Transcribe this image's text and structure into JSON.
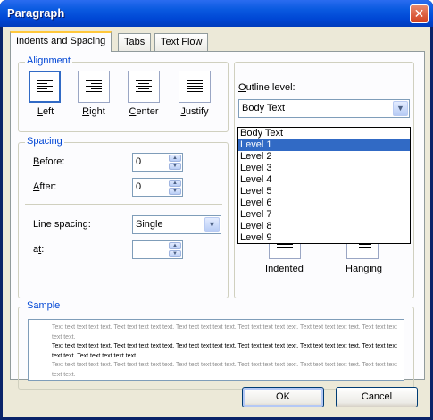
{
  "window": {
    "title": "Paragraph",
    "close_symbol": "✕"
  },
  "tabs": [
    {
      "label": "Indents and Spacing",
      "active": true
    },
    {
      "label": "Tabs",
      "active": false
    },
    {
      "label": "Text Flow",
      "active": false
    }
  ],
  "alignment": {
    "group_label": "Alignment",
    "options": [
      {
        "label_ul": "L",
        "label_rest": "eft",
        "selected": true
      },
      {
        "label_ul": "R",
        "label_rest": "ight",
        "selected": false
      },
      {
        "label_ul": "C",
        "label_rest": "enter",
        "selected": false
      },
      {
        "label_ul": "J",
        "label_rest": "ustify",
        "selected": false
      }
    ]
  },
  "spacing": {
    "group_label": "Spacing",
    "before_ul": "B",
    "before_rest": "efore:",
    "before_value": "0",
    "after_ul": "A",
    "after_rest": "fter:",
    "after_value": "0",
    "line_spacing_label": "Line spacing:",
    "line_spacing_value": "Single",
    "at_pre": "a",
    "at_ul": "t",
    "at_post": ":",
    "at_value": ""
  },
  "outline": {
    "label_ul": "O",
    "label_rest": "utline level:",
    "selected_value": "Body Text",
    "options": [
      "Body Text",
      "Level 1",
      "Level 2",
      "Level 3",
      "Level 4",
      "Level 5",
      "Level 6",
      "Level 7",
      "Level 8",
      "Level 9"
    ],
    "highlighted_index": 1
  },
  "indent_buttons": {
    "indented_ul": "I",
    "indented_rest": "ndented",
    "hanging_ul": "H",
    "hanging_rest": "anging"
  },
  "sample": {
    "group_label": "Sample",
    "prev_text": "Text text text text text. Text text text text text. Text text text text text. Text text text text text. Text text text text text. Text text text text text.",
    "cur_text": "Text text text text text. Text text text text text. Text text text text text. Text text text text text. Text text text text text. Text text text text text. Text text text text text.",
    "next_text": "Text text text text text. Text text text text text. Text text text text text. Text text text text text. Text text text text text. Text text text text text."
  },
  "buttons": {
    "ok": "OK",
    "cancel": "Cancel"
  }
}
